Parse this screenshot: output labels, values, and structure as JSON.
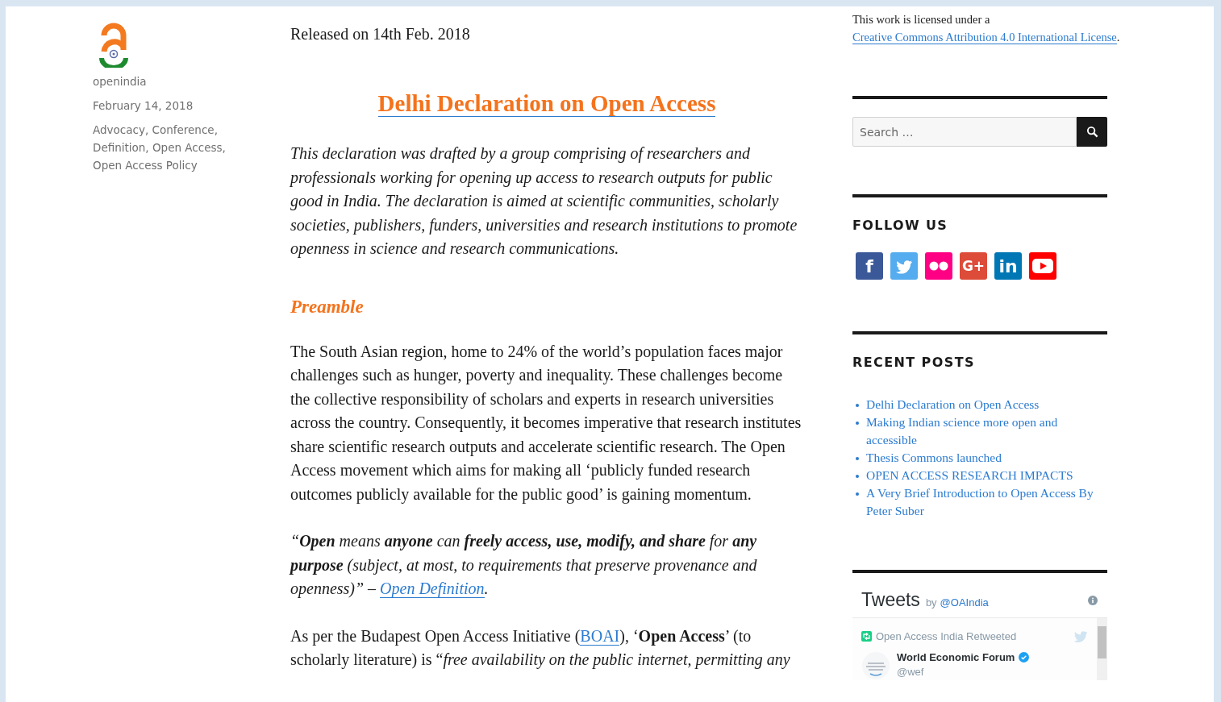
{
  "post_meta": {
    "author": "openindia",
    "date": "February 14, 2018",
    "categories": "Advocacy, Conference, Definition, Open Access, Open Access Policy"
  },
  "article": {
    "released": "Released on 14th Feb. 2018",
    "title": "Delhi Declaration on Open Access",
    "blocks": [
      {
        "kind": "intro",
        "parts": [
          {
            "kind": "text",
            "text": "This declaration was drafted by a group comprising of researchers and professionals working for opening up access to research outputs for public good in India. The declaration is aimed at scientific communities, scholarly societies, publishers, funders, universities and research institutions to promote openness in science and research communications."
          }
        ]
      },
      {
        "kind": "heading",
        "text": "Preamble"
      },
      {
        "kind": "text",
        "parts": [
          {
            "kind": "text",
            "text": "The South Asian region, home to 24% of the world’s population faces major challenges such as hunger, poverty and inequality. These challenges become the collective responsibility of scholars and experts in research universities across the country. Consequently, it becomes imperative that research institutes share scientific research outputs and accelerate scientific research. The Open Access movement which aims for making all ‘publicly funded research outcomes publicly available for the public good’ is gaining momentum."
          }
        ]
      },
      {
        "kind": "quote",
        "parts": [
          {
            "kind": "text",
            "text": "“**Open** means **anyone** can **freely access, use, modify, and share** for **any purpose** (subject, at most, to requirements that preserve provenance and openness)” – "
          },
          {
            "kind": "link",
            "text": "Open Definition"
          },
          {
            "kind": "text",
            "text": "."
          }
        ]
      },
      {
        "kind": "text",
        "parts": [
          {
            "kind": "text",
            "text": "As per the Budapest Open Access Initiative ("
          },
          {
            "kind": "link",
            "text": "BOAI"
          },
          {
            "kind": "text",
            "text": "), ‘**Open Access**’ (to scholarly literature) is “*free availability on the public internet, permitting any*"
          }
        ]
      }
    ]
  },
  "sidebar": {
    "license": [
      {
        "kind": "text",
        "text": "This work is licensed under a "
      },
      {
        "kind": "link",
        "text": "Creative Commons Attribution 4.0 International License"
      },
      {
        "kind": "text",
        "text": "."
      }
    ],
    "search": {
      "placeholder": "Search …"
    },
    "follow": {
      "heading": "FOLLOW US",
      "icons": [
        {
          "kind": "facebook",
          "color": "#3b5998",
          "glyph": "f"
        },
        {
          "kind": "twitter",
          "color": "#55acee"
        },
        {
          "kind": "flickr",
          "color": "#ff0084"
        },
        {
          "kind": "googleplus",
          "color": "#dd4b39",
          "glyph": "G+"
        },
        {
          "kind": "linkedin",
          "color": "#0077b5",
          "glyph": "in"
        },
        {
          "kind": "youtube",
          "color": "#ff0000"
        }
      ]
    },
    "recent_posts": {
      "heading": "RECENT POSTS",
      "items": [
        "Delhi Declaration on Open Access",
        "Making Indian science more open and accessible",
        "Thesis Commons launched",
        "OPEN ACCESS RESEARCH IMPACTS",
        "A Very Brief Introduction to Open Access By Peter Suber"
      ]
    },
    "tweets": {
      "title": "Tweets",
      "by": "by",
      "handle": "@OAIndia",
      "retweet_note": "Open Access India Retweeted",
      "author": "World Economic Forum",
      "verified": true,
      "author_handle": "@wef"
    }
  }
}
